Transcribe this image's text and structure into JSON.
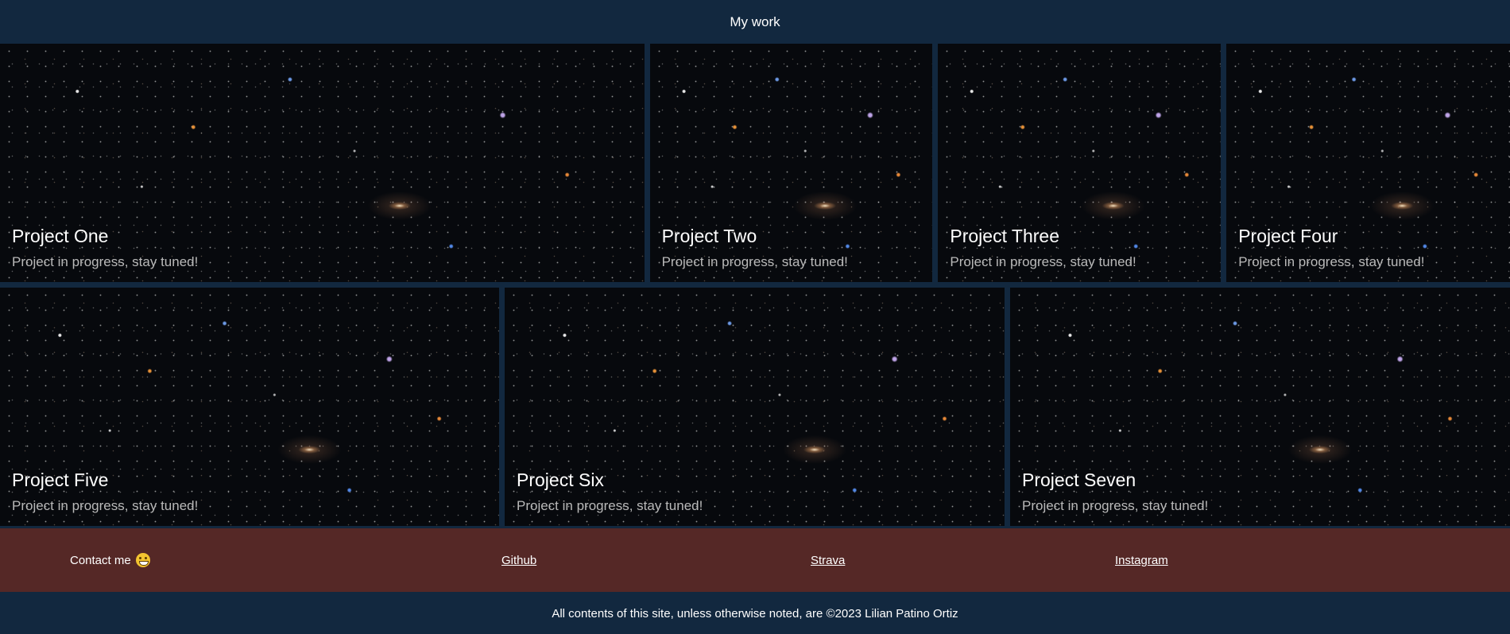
{
  "header": {
    "title": "My work"
  },
  "projects": [
    {
      "title": "Project One",
      "subtitle": "Project in progress, stay tuned!"
    },
    {
      "title": "Project Two",
      "subtitle": "Project in progress, stay tuned!"
    },
    {
      "title": "Project Three",
      "subtitle": "Project in progress, stay tuned!"
    },
    {
      "title": "Project Four",
      "subtitle": "Project in progress, stay tuned!"
    },
    {
      "title": "Project Five",
      "subtitle": "Project in progress, stay tuned!"
    },
    {
      "title": "Project Six",
      "subtitle": "Project in progress, stay tuned!"
    },
    {
      "title": "Project Seven",
      "subtitle": "Project in progress, stay tuned!"
    }
  ],
  "footer": {
    "contact_label": "Contact me",
    "contact_icon": "smiley-icon",
    "links": [
      "Github",
      "Strava",
      "Instagram"
    ],
    "copyright": "All contents of this site, unless otherwise noted, are ©2023 Lilian Patino Ortiz"
  },
  "colors": {
    "header_bg": "#12283f",
    "footer_bg": "#552826",
    "subtitle": "#b9b9b9"
  }
}
